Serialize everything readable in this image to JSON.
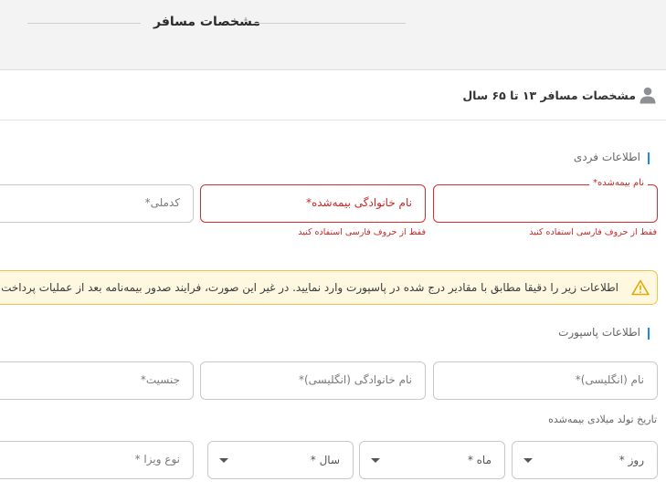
{
  "page_title": "مشخصات مسافر",
  "card": {
    "title": "مشخصات مسافر ۱۳ تا ۶۵ سال",
    "personal_section": "اطلاعات فردی",
    "passport_section": "اطلاعات پاسپورت",
    "dob_label": "تاریخ تولد میلادی بیمه‌شده"
  },
  "fields": {
    "insured_name_label": "نام بیمه‌شده*",
    "insured_family_placeholder": "نام خانوادگی بیمه‌شده*",
    "national_code_placeholder": "کدملی*",
    "persian_hint_1": "فقط از حروف فارسی استفاده کنید",
    "persian_hint_2": "فقط از حروف فارسی استفاده کنید",
    "english_name_placeholder": "نام (انگلیسی)*",
    "english_family_placeholder": "نام خانوادگی (انگلیسی)*",
    "gender_placeholder": "جنسیت*",
    "day_placeholder": "روز *",
    "month_placeholder": "ماه *",
    "year_placeholder": "سال *",
    "visa_type_placeholder": "نوع ویزا *"
  },
  "alert": {
    "text": "اطلاعات زیر را دقیقا مطابق با مقادیر درج شده در پاسپورت وارد نمایید. در غیر این صورت، فرایند صدور بیمه‌نامه بعد از عملیات پرداخت با"
  },
  "icons": {
    "person": "person-icon",
    "warning": "warning-icon",
    "dropdown": "chevron-down-icon"
  },
  "colors": {
    "accent": "#1e88e5",
    "error": "#d32f2f",
    "warning_bg": "#fff8e1",
    "warning_border": "#f0c14b"
  }
}
